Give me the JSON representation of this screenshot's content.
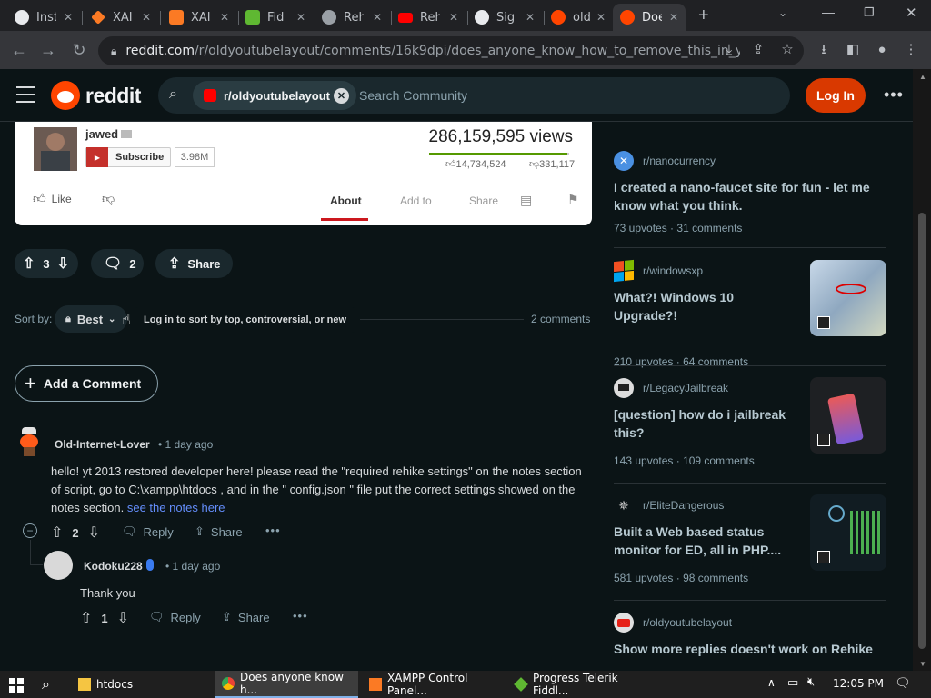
{
  "browser": {
    "tabs": [
      {
        "label": "Inst",
        "icon": "github-icon"
      },
      {
        "label": "XAI",
        "icon": "xampp-icon"
      },
      {
        "label": "XAI",
        "icon": "xampp-icon"
      },
      {
        "label": "Fid",
        "icon": "fiddler-icon"
      },
      {
        "label": "Reh",
        "icon": "globe-icon"
      },
      {
        "label": "Reh",
        "icon": "youtube-icon"
      },
      {
        "label": "Sig",
        "icon": "github-icon"
      },
      {
        "label": "old",
        "icon": "reddit-icon"
      },
      {
        "label": "Doe",
        "icon": "reddit-icon",
        "active": true
      }
    ],
    "url_host": "reddit.com",
    "url_path": "/r/oldyoutubelayout/comments/16k9dpi/does_anyone_know_how_to_remove_this_in_yout..."
  },
  "header": {
    "brand": "reddit",
    "subreddit_chip": "r/oldyoutubelayout",
    "search_placeholder": "Search Community",
    "login": "Log In"
  },
  "embed": {
    "channel": "jawed",
    "subscribe": "Subscribe",
    "sub_count": "3.98M",
    "views": "286,159,595 views",
    "likes": "14,734,524",
    "dislikes": "331,117",
    "like_label": "Like",
    "tabs": [
      "About",
      "Add to",
      "Share"
    ]
  },
  "post": {
    "score": "3",
    "comments": "2",
    "share": "Share"
  },
  "sort": {
    "label": "Sort by:",
    "value": "Best",
    "tooltip": "Log in to sort by top, controversial, or new",
    "count": "2 comments"
  },
  "add_comment": "Add a Comment",
  "comments": [
    {
      "author": "Old-Internet-Lover",
      "time": "1 day ago",
      "body": "hello! yt 2013 restored developer here! please read the \"required rehike settings\" on the notes section of script, go to C:\\xampp\\htdocs , and in the \" config.json \" file put the correct settings showed on the notes section.",
      "link": "see the notes here",
      "score": "2",
      "reply": "Reply",
      "share": "Share"
    },
    {
      "author": "Kodoku228",
      "time": "1 day ago",
      "body": "Thank you",
      "score": "1",
      "reply": "Reply",
      "share": "Share"
    }
  ],
  "sidebar": [
    {
      "sub": "r/nanocurrency",
      "title": "I created a nano-faucet site for fun - let me know what you think.",
      "upvotes": "73 upvotes",
      "comments": "31 comments"
    },
    {
      "sub": "r/windowsxp",
      "title": "What?! Windows 10 Upgrade?!",
      "upvotes": "210 upvotes",
      "comments": "64 comments"
    },
    {
      "sub": "r/LegacyJailbreak",
      "title": "[question] how do i jailbreak this?",
      "upvotes": "143 upvotes",
      "comments": "109 comments"
    },
    {
      "sub": "r/EliteDangerous",
      "title": "Built a Web based status monitor for ED, all in PHP....",
      "upvotes": "581 upvotes",
      "comments": "98 comments"
    },
    {
      "sub": "r/oldyoutubelayout",
      "title": "Show more replies doesn't work on Rehike"
    }
  ],
  "taskbar": {
    "apps": [
      "htdocs",
      "Does anyone know h...",
      "XAMPP Control Panel...",
      "Progress Telerik Fiddl..."
    ],
    "time": "12:05 PM"
  },
  "colors": {
    "reddit_orange": "#ff4500",
    "login_bg": "#d93900",
    "link_blue": "#648efc",
    "page_bg": "#0b1416"
  }
}
